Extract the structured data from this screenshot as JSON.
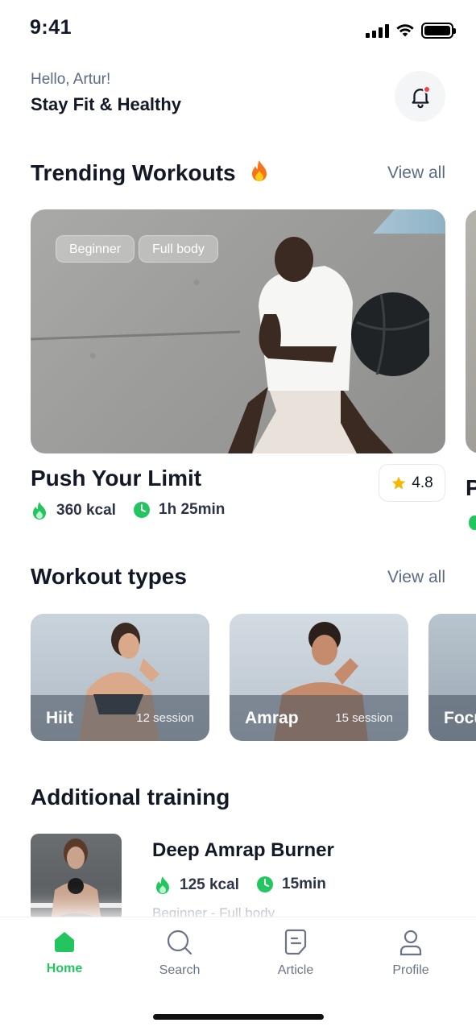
{
  "status_bar": {
    "time": "9:41"
  },
  "header": {
    "greeting": "Hello, Artur!",
    "headline": "Stay Fit & Healthy"
  },
  "trending": {
    "title": "Trending Workouts",
    "view_all": "View all",
    "card": {
      "tags": [
        "Beginner",
        "Full body"
      ],
      "title": "Push Your Limit",
      "calories": "360 kcal",
      "duration": "1h 25min",
      "rating": "4.8"
    },
    "next_card_letter": "P"
  },
  "workout_types": {
    "title": "Workout types",
    "view_all": "View all",
    "items": [
      {
        "name": "Hiit",
        "sessions": "12 session"
      },
      {
        "name": "Amrap",
        "sessions": "15 session"
      },
      {
        "name": "Focu"
      }
    ]
  },
  "additional": {
    "title": "Additional training",
    "item": {
      "title": "Deep Amrap Burner",
      "calories": "125 kcal",
      "duration": "15min",
      "subtitle": "Beginner - Full body"
    }
  },
  "nav": {
    "items": [
      {
        "label": "Home",
        "icon": "home-icon",
        "active": true
      },
      {
        "label": "Search",
        "icon": "search-icon",
        "active": false
      },
      {
        "label": "Article",
        "icon": "article-icon",
        "active": false
      },
      {
        "label": "Profile",
        "icon": "profile-icon",
        "active": false
      }
    ]
  },
  "colors": {
    "accent": "#22c55e",
    "notification": "#ef4444",
    "star": "#f5b700",
    "text": "#121826",
    "muted": "#5b6b86"
  }
}
